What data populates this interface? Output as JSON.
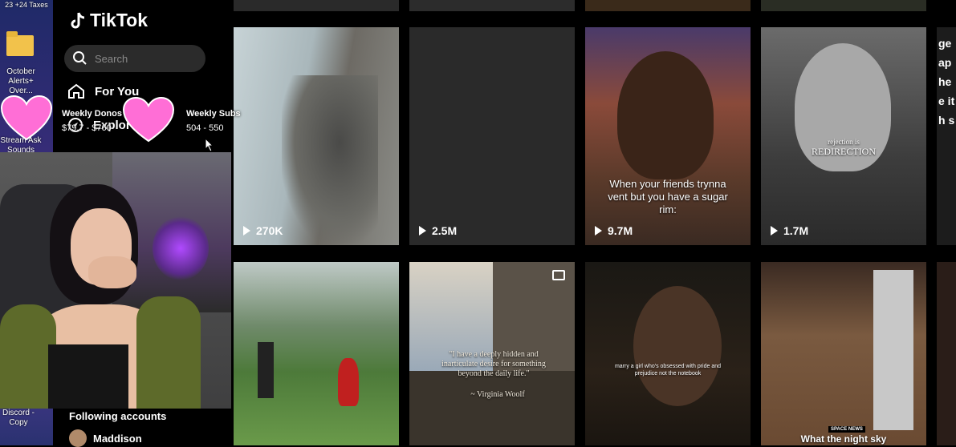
{
  "desktop": {
    "top_label": "23 +24 Taxes",
    "icon1_label": "October Alerts+ Over...",
    "icon2_label": "Stream Ask Sounds",
    "icon3_label": "Discord - Copy"
  },
  "sidebar": {
    "brand": "TikTok",
    "search_placeholder": "Search",
    "nav": [
      {
        "label": "For You",
        "icon": "home-icon"
      },
      {
        "label": "Explore",
        "icon": "compass-icon"
      }
    ],
    "following_heading": "Following accounts",
    "following": [
      {
        "name": "Maddison"
      }
    ]
  },
  "overlay": {
    "donos_title": "Weekly Donos",
    "donos_value": "$79.7 - $760",
    "subs_title": "Weekly Subs",
    "subs_value": "504 - 550"
  },
  "grid": {
    "row1": [
      {
        "views": "270K"
      },
      {
        "views": "2.5M"
      },
      {
        "views": "9.7M",
        "caption": "When your friends trynna vent but you have a sugar rim:"
      },
      {
        "views": "1.7M",
        "caption_small": "rejection is",
        "caption_big": "REDIRECTION"
      }
    ],
    "row1_partial_text": "ge ap he e ith s",
    "row2": [
      {
        "caption": ""
      },
      {
        "quote": "\"I have a deeply hidden and inarticulate desire for something beyond the daily life.\"",
        "author": "~ Virginia Woolf"
      },
      {
        "caption": "marry a girl who's obsessed with pride and prejudice not the notebook"
      },
      {
        "badge": "SPACE NEWS",
        "caption": "What the night sky"
      }
    ]
  },
  "colors": {
    "heart": "#ff6ed6",
    "accent": "#fe2c55",
    "tile_bg": "#2a2a2a"
  }
}
